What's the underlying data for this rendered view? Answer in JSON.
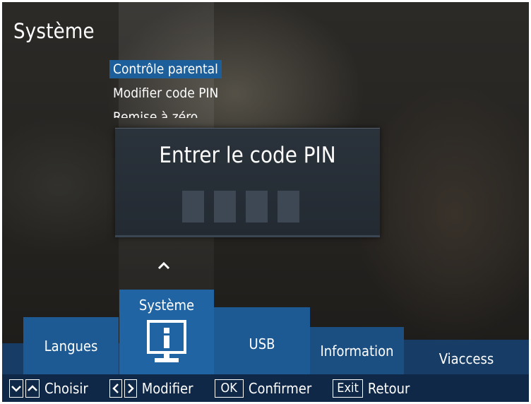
{
  "page_title": "Système",
  "menu": {
    "items": [
      {
        "label": "Contrôle parental",
        "selected": true
      },
      {
        "label": "Modifier code PIN",
        "selected": false
      },
      {
        "label": "Remise à zéro",
        "selected": false,
        "partially_hidden": true
      }
    ]
  },
  "pin_dialog": {
    "title": "Entrer le code PIN",
    "digit_count": 4
  },
  "scroll_up_icon": "chevron-up-icon",
  "tabs": [
    {
      "label": "Langues",
      "active": false
    },
    {
      "label": "Système",
      "active": true,
      "icon": "info-monitor-icon"
    },
    {
      "label": "USB",
      "active": false
    },
    {
      "label": "Information",
      "active": false
    },
    {
      "label": "Viaccess",
      "active": false
    }
  ],
  "hints": {
    "choose": {
      "keys": [
        "chevron-down-icon",
        "chevron-up-icon"
      ],
      "label": "Choisir"
    },
    "modify": {
      "keys": [
        "chevron-left-icon",
        "chevron-right-icon"
      ],
      "label": "Modifier"
    },
    "confirm": {
      "key": "OK",
      "label": "Confirmer"
    },
    "back": {
      "key": "Exit",
      "label": "Retour"
    }
  },
  "colors": {
    "selected_item": "#1d5f9a",
    "active_tab": "#2164a3",
    "tab": "#1d5a93",
    "hint_bar": "#0f2847",
    "dialog": "#2a323b",
    "pin_box": "#3d4854"
  }
}
